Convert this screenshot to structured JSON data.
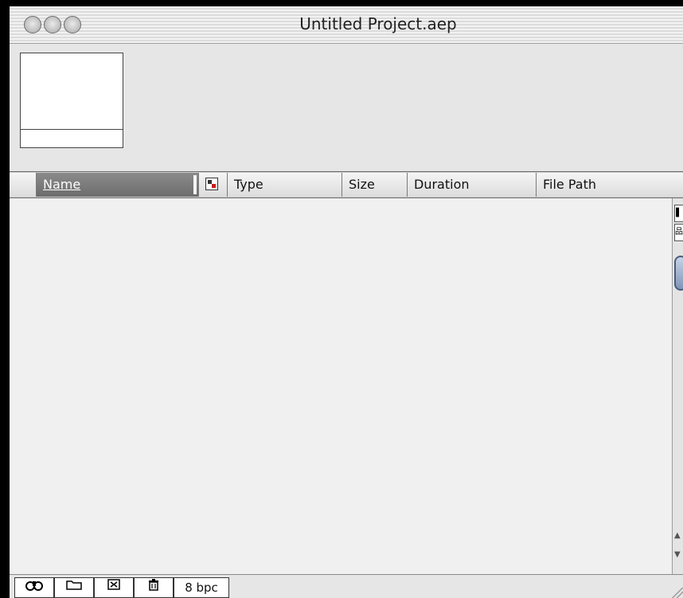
{
  "window": {
    "title": "Untitled Project.aep"
  },
  "columns": {
    "name": "Name",
    "type": "Type",
    "size": "Size",
    "duration": "Duration",
    "file_path": "File Path"
  },
  "footer": {
    "bpc_label": "8 bpc",
    "icons": [
      "binoculars-icon",
      "folder-icon",
      "composition-icon",
      "trash-icon"
    ]
  },
  "scrollbar": {
    "top_buttons": [
      "flowchart-icon",
      "network-icon"
    ]
  },
  "colors": {
    "window_bg": "#e6e6e6",
    "list_bg": "#f0f0f0",
    "name_header_bg": "#6d6d6d",
    "label_icon_red": "#c81e1e",
    "label_icon_green": "#2f8f2f"
  }
}
